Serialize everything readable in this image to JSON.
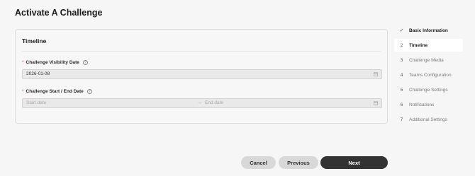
{
  "page": {
    "title": "Activate A Challenge"
  },
  "card": {
    "title": "Timeline",
    "visibility_field": {
      "label": "Challenge Visibility Date",
      "required_marker": "*",
      "help_glyph": "?",
      "value": "2026-01-08"
    },
    "range_field": {
      "label": "Challenge Start / End Date",
      "required_marker": "*",
      "help_glyph": "?",
      "start_placeholder": "Start date",
      "end_placeholder": "End date",
      "arrow": "→"
    }
  },
  "steps": [
    {
      "num": "✓",
      "label": "Basic Information",
      "state": "done"
    },
    {
      "num": "2",
      "label": "Timeline",
      "state": "active"
    },
    {
      "num": "3",
      "label": "Challenge Media",
      "state": "pending"
    },
    {
      "num": "4",
      "label": "Teams Configuration",
      "state": "pending"
    },
    {
      "num": "5",
      "label": "Challenge Settings",
      "state": "pending"
    },
    {
      "num": "6",
      "label": "Notifications",
      "state": "pending"
    },
    {
      "num": "7",
      "label": "Additional Settings",
      "state": "pending"
    }
  ],
  "buttons": {
    "cancel": "Cancel",
    "previous": "Previous",
    "next": "Next"
  },
  "colors": {
    "primary_button": "#333333",
    "secondary_button": "#d8d8d8",
    "required": "#e0453a"
  },
  "icons": {
    "calendar": "calendar-icon",
    "help": "help-circle-icon",
    "check": "check-icon"
  }
}
